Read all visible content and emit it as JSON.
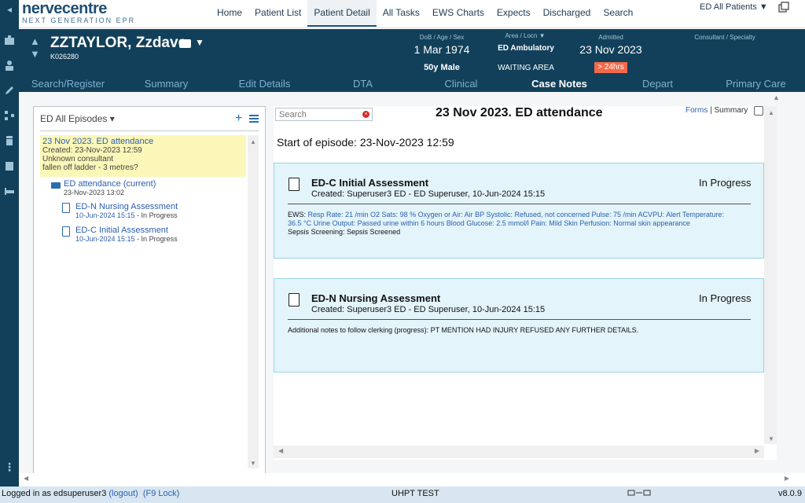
{
  "app": {
    "logo_main": "nervecentre",
    "logo_sub": "NEXT GENERATION EPR"
  },
  "nav": {
    "items": [
      {
        "label": "Home"
      },
      {
        "label": "Patient List"
      },
      {
        "label": "Patient Detail",
        "active": true
      },
      {
        "label": "All Tasks"
      },
      {
        "label": "EWS Charts"
      },
      {
        "label": "Expects"
      },
      {
        "label": "Discharged"
      },
      {
        "label": "Search"
      }
    ],
    "patient_list_selector": "ED All Patients ▼"
  },
  "patient": {
    "name": "ZZTAYLOR, Zzdave",
    "id": "K026280",
    "dob_label": "DoB / Age / Sex",
    "dob": "1 Mar 1974",
    "age_sex": "50y Male",
    "area_label": "Area / Locn ▼",
    "area": "ED Ambulatory",
    "location": "WAITING AREA",
    "admitted_label": "Admitted",
    "admitted": "23 Nov 2023",
    "duration_badge": "> 24hrs",
    "consultant_label": "Consultant / Specialty"
  },
  "tabs": [
    {
      "label": "Search/Register"
    },
    {
      "label": "Summary"
    },
    {
      "label": "Edit Details"
    },
    {
      "label": "DTA"
    },
    {
      "label": "Clinical"
    },
    {
      "label": "Case Notes",
      "active": true
    },
    {
      "label": "Depart"
    },
    {
      "label": "Primary Care"
    }
  ],
  "episodes": {
    "header": "ED All Episodes ▾",
    "add_label": "+",
    "selected": {
      "title": "23 Nov 2023. ED attendance",
      "created": "Created: 23-Nov-2023 12:59",
      "consultant": "Unknown consultant",
      "complaint": "fallen off ladder - 3 metres?"
    },
    "attendance": {
      "title": "ED attendance (current)",
      "date": "23-Nov-2023 13:02"
    },
    "forms": [
      {
        "title": "ED-N Nursing Assessment",
        "date": "10-Jun-2024 15:15",
        "status": " - In Progress"
      },
      {
        "title": "ED-C Initial Assessment",
        "date": "10-Jun-2024 15:15",
        "status": " - In Progress"
      }
    ]
  },
  "notes": {
    "search_placeholder": "Search",
    "title": "23 Nov 2023. ED attendance",
    "forms_link": "Forms",
    "separator": " | ",
    "summary_link": "Summary",
    "start_of_episode": "Start of episode: 23-Nov-2023 12:59",
    "cards": [
      {
        "title": "ED-C Initial Assessment",
        "created": "Created: Superuser3 ED - ED Superuser, 10-Jun-2024 15:15",
        "status": "In Progress",
        "ews_label": "EWS: ",
        "ews_text": "Resp Rate: 21 /min O2 Sats: 98 % Oxygen or Air: Air BP Systolic: Refused, not concerned Pulse: 75 /min ACVPU: Alert Temperature: 36.5 °C Urine Output: Passed urine within 6 hours Blood Glucose: 2.5 mmol/l Pain: Mild Skin Perfusion: Normal skin appearance",
        "extra": "Sepsis Screening: Sepsis Screened"
      },
      {
        "title": "ED-N Nursing Assessment",
        "created": "Created: Superuser3 ED - ED Superuser, 10-Jun-2024 15:15",
        "status": "In Progress",
        "extra": "Additional notes to follow clerking (progress): PT MENTION HAD INJURY REFUSED ANY FURTHER DETAILS."
      }
    ]
  },
  "footer": {
    "logged_in": "Logged in as edsuperuser3 ",
    "logout": "(logout)",
    "lock": "(F9 Lock)",
    "environment": "UHPT TEST",
    "version": "v8.0.9"
  },
  "colors": {
    "banner": "#12405a",
    "accent": "#2b5fb0",
    "badge": "#f26a4b",
    "card_bg": "#e3f4fa",
    "selected_bg": "#fbf7b8"
  }
}
